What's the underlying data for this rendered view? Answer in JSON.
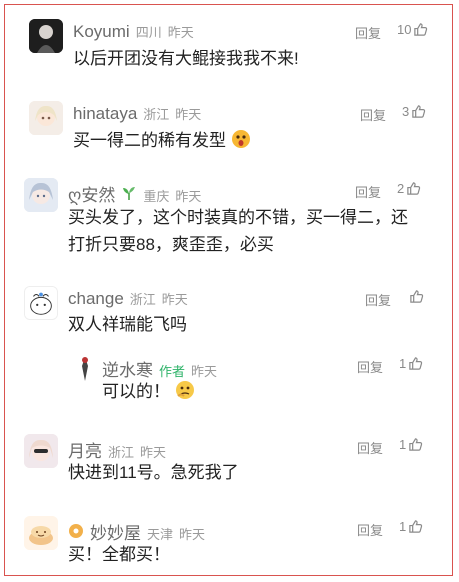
{
  "reply_label": "回复",
  "colors": {
    "frame_border": "#d9534f",
    "author_tag": "#2fb36a"
  },
  "comments": [
    {
      "name": "Koyumi",
      "location": "四川",
      "time": "昨天",
      "likes": "10",
      "text": "以后开团没有大鲲接我我不来!"
    },
    {
      "name": "hinataya",
      "location": "浙江",
      "time": "昨天",
      "likes": "3",
      "text": "买一得二的稀有发型"
    },
    {
      "name": "ღ安然",
      "location": "重庆",
      "time": "昨天",
      "likes": "2",
      "text": "买头发了，这个时装真的不错，买一得二，还打折只要88，爽歪歪，必买"
    },
    {
      "name": "change",
      "location": "浙江",
      "time": "昨天",
      "likes": "",
      "text": "双人祥瑞能飞吗"
    },
    {
      "name": "逆水寒",
      "author_tag": "作者",
      "time": "昨天",
      "likes": "1",
      "text": "可以的！"
    },
    {
      "name": "月亮",
      "location": "浙江",
      "time": "昨天",
      "likes": "1",
      "text": "快进到11号。急死我了"
    },
    {
      "name": "妙妙屋",
      "location": "天津",
      "time": "昨天",
      "likes": "1",
      "text": "买！全都买！"
    }
  ]
}
